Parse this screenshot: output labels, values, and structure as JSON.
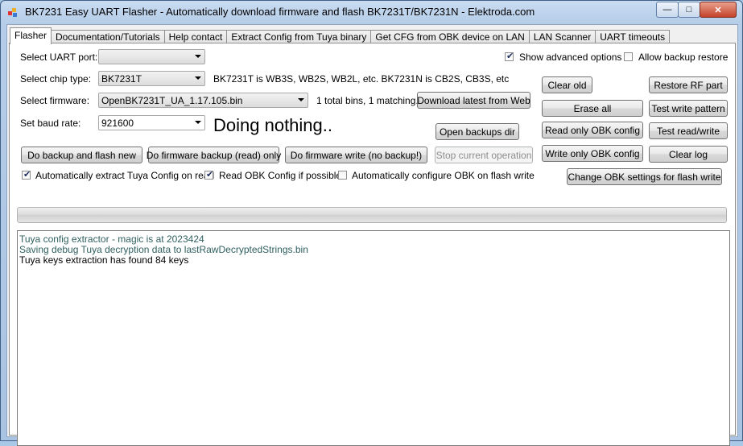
{
  "window": {
    "title": "BK7231 Easy UART Flasher - Automatically download firmware and flash BK7231T/BK7231N  - Elektroda.com",
    "minimize_glyph": "—",
    "maximize_glyph": "□",
    "close_glyph": "✕"
  },
  "tabs": [
    {
      "label": "Flasher"
    },
    {
      "label": "Documentation/Tutorials"
    },
    {
      "label": "Help contact"
    },
    {
      "label": "Extract Config from Tuya binary"
    },
    {
      "label": "Get CFG from OBK device on LAN"
    },
    {
      "label": "LAN Scanner"
    },
    {
      "label": "UART timeouts"
    }
  ],
  "form": {
    "uart_label": "Select UART port:",
    "uart_value": "",
    "chip_label": "Select chip type:",
    "chip_value": "BK7231T",
    "chip_info": "BK7231T is WB3S, WB2S, WB2L, etc. BK7231N is CB2S, CB3S, etc",
    "firmware_label": "Select firmware:",
    "firmware_value": "OpenBK7231T_UA_1.17.105.bin",
    "bins_info": "1 total bins, 1 matching.",
    "baud_label": "Set baud rate:",
    "baud_value": "921600",
    "status": "Doing nothing.."
  },
  "options": {
    "show_advanced": {
      "label": "Show advanced options",
      "checked": true
    },
    "allow_backup_restore": {
      "label": "Allow backup restore",
      "checked": false
    },
    "auto_extract_tuya": {
      "label": "Automatically extract Tuya Config on read",
      "checked": true
    },
    "read_obk_config": {
      "label": "Read OBK Config if possible",
      "checked": true
    },
    "auto_configure_obk": {
      "label": "Automatically configure OBK on flash write",
      "checked": false
    }
  },
  "buttons": {
    "download_latest": "Download latest from Web",
    "open_backups": "Open backups dir",
    "backup_flash_new": "Do backup and flash new",
    "firmware_backup": "Do firmware backup (read) only",
    "firmware_write": "Do firmware write (no backup!)",
    "stop_operation": "Stop current operation",
    "clear_old": "Clear old",
    "restore_rf": "Restore RF part",
    "erase_all": "Erase all",
    "test_write_pattern": "Test write pattern",
    "read_only_obk": "Read only OBK config",
    "test_read_write": "Test read/write",
    "write_only_obk": "Write only OBK config",
    "clear_log": "Clear log",
    "change_obk_settings": "Change OBK settings for flash write"
  },
  "progress": {
    "value": 0
  },
  "log": {
    "lines": [
      {
        "text": "Tuya config extractor - magic is at 2023424",
        "color": "#2f5f5f"
      },
      {
        "text": "Saving debug Tuya decryption data to lastRawDecryptedStrings.bin",
        "color": "#2f5f5f"
      },
      {
        "text": "Tuya keys extraction has found 84 keys",
        "color": "#000000"
      }
    ]
  }
}
